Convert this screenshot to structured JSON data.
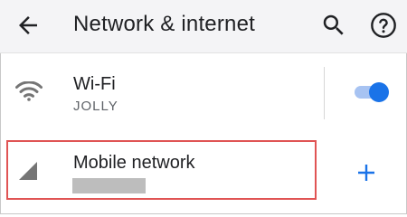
{
  "header": {
    "title": "Network & internet",
    "back_icon": "arrow-back-icon",
    "search_icon": "search-icon",
    "help_icon": "help-icon"
  },
  "wifi": {
    "label": "Wi-Fi",
    "network": "JOLLY",
    "enabled": true,
    "icon": "wifi-icon"
  },
  "mobile": {
    "label": "Mobile network",
    "icon": "signal-icon",
    "add_icon": "add-icon"
  },
  "colors": {
    "accent": "#1a73e8",
    "highlight": "#e05454",
    "header_bg": "#f4f4f6"
  }
}
